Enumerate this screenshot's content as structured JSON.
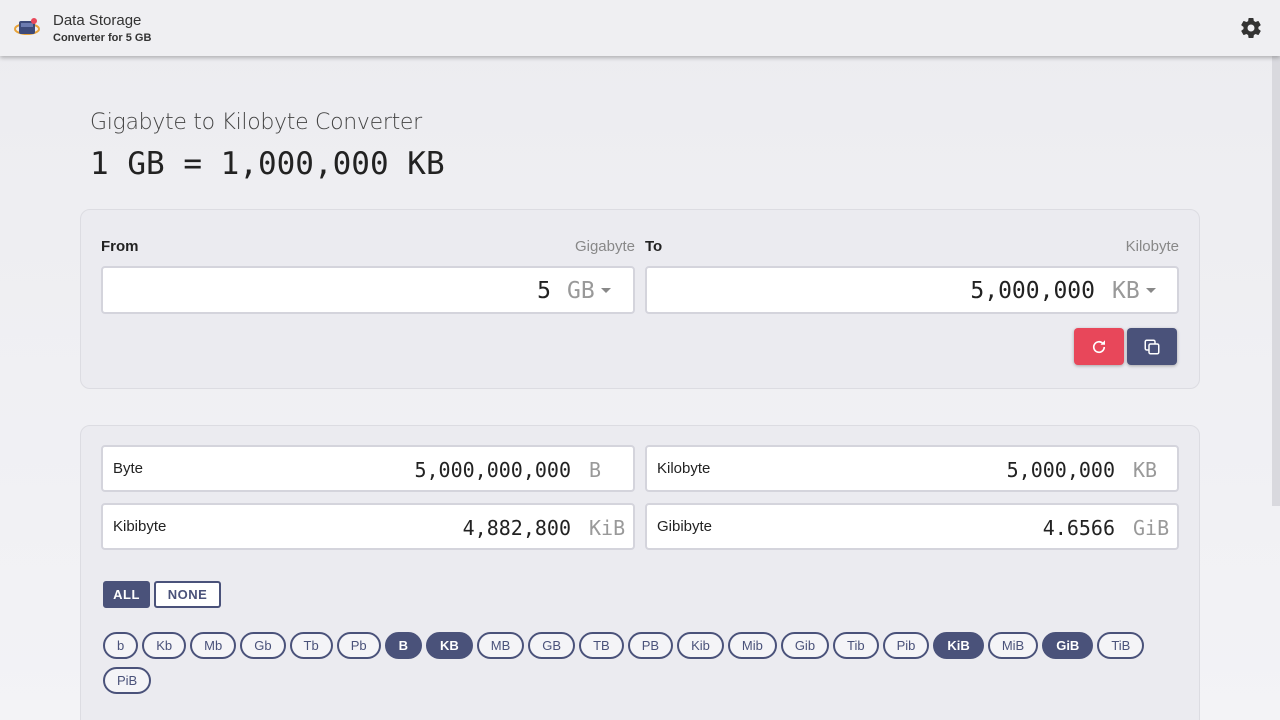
{
  "header": {
    "title": "Data Storage",
    "subtitle": "Converter for 5 GB",
    "settings_icon": "gear-icon",
    "logo_icon": "storage-logo-icon"
  },
  "page": {
    "title": "Gigabyte to Kilobyte Converter",
    "formula": "1 GB = 1,000,000 KB"
  },
  "converter": {
    "from_label": "From",
    "from_unit_name": "Gigabyte",
    "from_value": "5",
    "from_unit": "GB",
    "to_label": "To",
    "to_unit_name": "Kilobyte",
    "to_value": "5,000,000",
    "to_unit": "KB",
    "reset_icon": "refresh-icon",
    "copy_icon": "copy-icon"
  },
  "results": [
    {
      "name": "Byte",
      "value": "5,000,000,000",
      "unit": "B"
    },
    {
      "name": "Kilobyte",
      "value": "5,000,000",
      "unit": "KB"
    },
    {
      "name": "Kibibyte",
      "value": "4,882,800",
      "unit": "KiB"
    },
    {
      "name": "Gibibyte",
      "value": "4.6566",
      "unit": "GiB"
    }
  ],
  "toggles": {
    "all": "ALL",
    "none": "NONE"
  },
  "units": [
    {
      "label": "b",
      "active": false
    },
    {
      "label": "Kb",
      "active": false
    },
    {
      "label": "Mb",
      "active": false
    },
    {
      "label": "Gb",
      "active": false
    },
    {
      "label": "Tb",
      "active": false
    },
    {
      "label": "Pb",
      "active": false
    },
    {
      "label": "B",
      "active": true
    },
    {
      "label": "KB",
      "active": true
    },
    {
      "label": "MB",
      "active": false
    },
    {
      "label": "GB",
      "active": false
    },
    {
      "label": "TB",
      "active": false
    },
    {
      "label": "PB",
      "active": false
    },
    {
      "label": "Kib",
      "active": false
    },
    {
      "label": "Mib",
      "active": false
    },
    {
      "label": "Gib",
      "active": false
    },
    {
      "label": "Tib",
      "active": false
    },
    {
      "label": "Pib",
      "active": false
    },
    {
      "label": "KiB",
      "active": true
    },
    {
      "label": "MiB",
      "active": false
    },
    {
      "label": "GiB",
      "active": true
    },
    {
      "label": "TiB",
      "active": false
    },
    {
      "label": "PiB",
      "active": false
    }
  ],
  "colors": {
    "accent": "#4a527a",
    "reset": "#e8475a",
    "background": "#ececf0"
  }
}
